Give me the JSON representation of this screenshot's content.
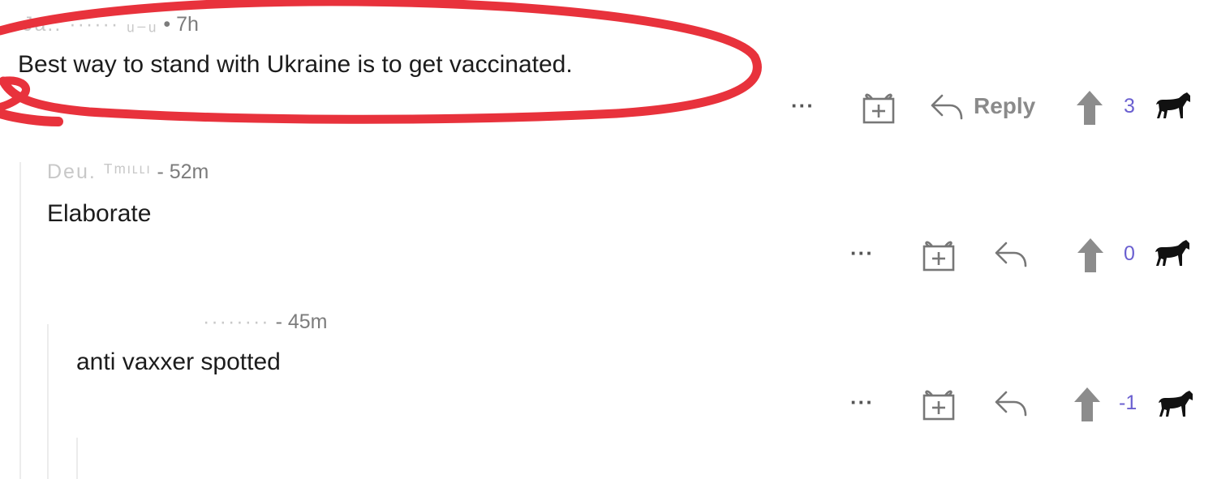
{
  "comments": [
    {
      "author_redacted": "Ja..  ······  ᵤ₋ᵤ",
      "timestamp": "7h",
      "text": "Best way to stand with Ukraine is to get vaccinated.",
      "more_label": "···",
      "reply_label": "Reply",
      "votes": "3"
    },
    {
      "author_redacted": "Deu.  ᵀᵐᶦᶫᶫᶦ",
      "timestamp": "52m",
      "text": "Elaborate",
      "more_label": "···",
      "votes": "0"
    },
    {
      "author_redacted": "········",
      "timestamp": "45m",
      "text": "anti vaxxer spotted",
      "more_label": "···",
      "votes": "-1"
    }
  ],
  "icons": {
    "more": "ellipsis-icon",
    "award": "gift-award-icon",
    "reply": "reply-arrow-icon",
    "upvote": "upvote-arrow-icon",
    "horse": "horse-icon"
  },
  "colors": {
    "annotation": "#e8323c",
    "vote_count": "#6a5fd0",
    "upvote_arrow": "#8c8c8c",
    "meta_text": "#7c7c7c"
  }
}
